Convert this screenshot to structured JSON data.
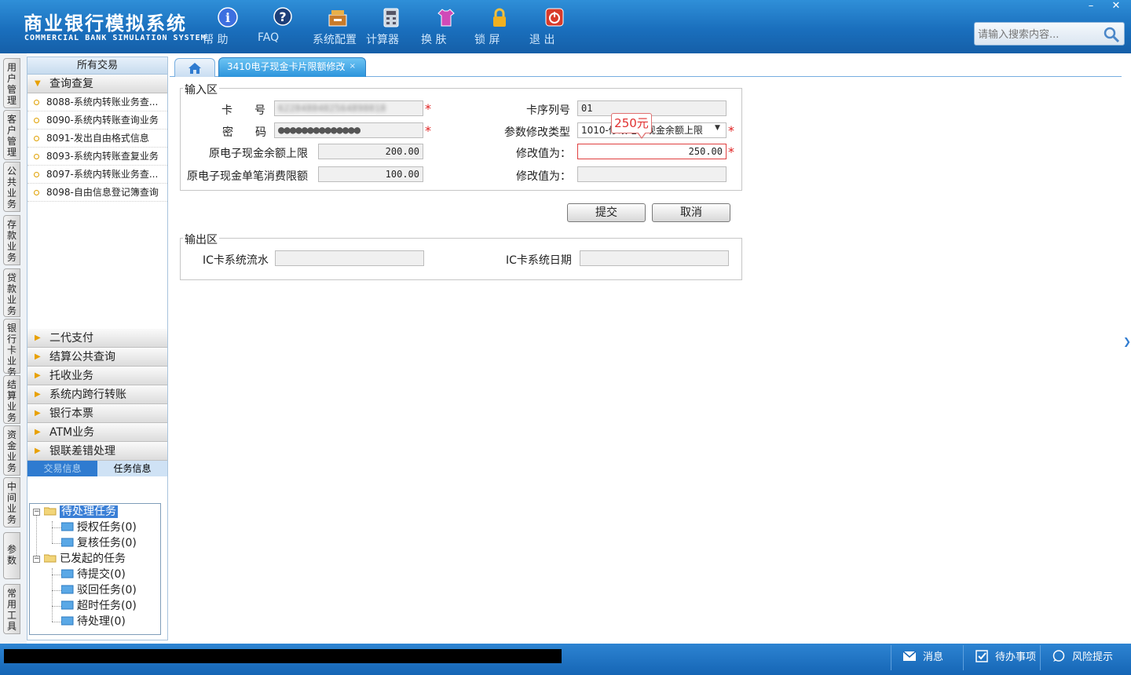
{
  "app": {
    "title_cn": "商业银行模拟系统",
    "title_en": "COMMERCIAL BANK SIMULATION SYSTEM"
  },
  "toolbar": [
    {
      "label": "帮 助",
      "icon": "help-icon"
    },
    {
      "label": "FAQ",
      "icon": "faq-icon"
    },
    {
      "label": "系统配置",
      "icon": "toolbox-icon"
    },
    {
      "label": "计算器",
      "icon": "calculator-icon"
    },
    {
      "label": "换 肤",
      "icon": "tshirt-icon"
    },
    {
      "label": "锁 屏",
      "icon": "lock-icon"
    },
    {
      "label": "退 出",
      "icon": "power-icon"
    }
  ],
  "window_controls": {
    "minimize": "–",
    "close": "✕"
  },
  "search": {
    "placeholder": "请输入搜索内容..."
  },
  "vertical_tabs": [
    "用户管理",
    "客户管理",
    "公共业务",
    "存款业务",
    "贷款业务",
    "银行卡业务",
    "结算业务",
    "资金业务",
    "中间业务",
    "参数",
    "常用工具"
  ],
  "sidebar": {
    "title": "所有交易",
    "open_group": "查询查复",
    "transactions": [
      "8088-系统内转账业务查...",
      "8090-系统内转账查询业务",
      "8091-发出自由格式信息",
      "8093-系统内转账查复业务",
      "8097-系统内转账业务查...",
      "8098-自由信息登记簿查询"
    ],
    "groups": [
      "二代支付",
      "结算公共查询",
      "托收业务",
      "系统内跨行转账",
      "银行本票",
      "ATM业务",
      "银联差错处理"
    ]
  },
  "task_panel": {
    "tabs": [
      "交易信息",
      "任务信息"
    ],
    "tree": {
      "pending": "待处理任务",
      "pending_children": [
        "授权任务(0)",
        "复核任务(0)"
      ],
      "initiated": "已发起的任务",
      "initiated_children": [
        "待提交(0)",
        "驳回任务(0)",
        "超时任务(0)",
        "待处理(0)"
      ]
    }
  },
  "tabs": {
    "active": "3410电子现金卡片限额修改",
    "close": "×"
  },
  "form": {
    "input_legend": "输入区",
    "card_no_label": "卡　　号",
    "card_no_value": "6228480402564890018",
    "card_seq_label": "卡序列号",
    "card_seq_value": "01",
    "password_label": "密　　码",
    "password_value": "●●●●●●●●●●●●●●",
    "param_type_label": "参数修改类型",
    "param_type_value": "1010-修改电子现金余额上限",
    "orig_balance_label": "原电子现金余额上限",
    "orig_balance_value": "200.00",
    "modify_to_label1": "修改值为：",
    "modify_to_value1": "250.00",
    "orig_single_label": "原电子现金单笔消费限额",
    "orig_single_value": "100.00",
    "modify_to_label2": "修改值为：",
    "modify_to_value2": "",
    "tooltip": "250元",
    "submit": "提交",
    "cancel": "取消",
    "output_legend": "输出区",
    "ic_serial_label": "IC卡系统流水",
    "ic_serial_value": "",
    "ic_date_label": "IC卡系统日期",
    "ic_date_value": "",
    "required_mark": "*"
  },
  "statusbar": {
    "messages": "消息",
    "todo": "待办事项",
    "risk": "风险提示"
  },
  "colors": {
    "header": "#1a6fbd",
    "accent": "#2f7bd0",
    "required": "#e02020",
    "group_arrow": "#e8a100"
  }
}
